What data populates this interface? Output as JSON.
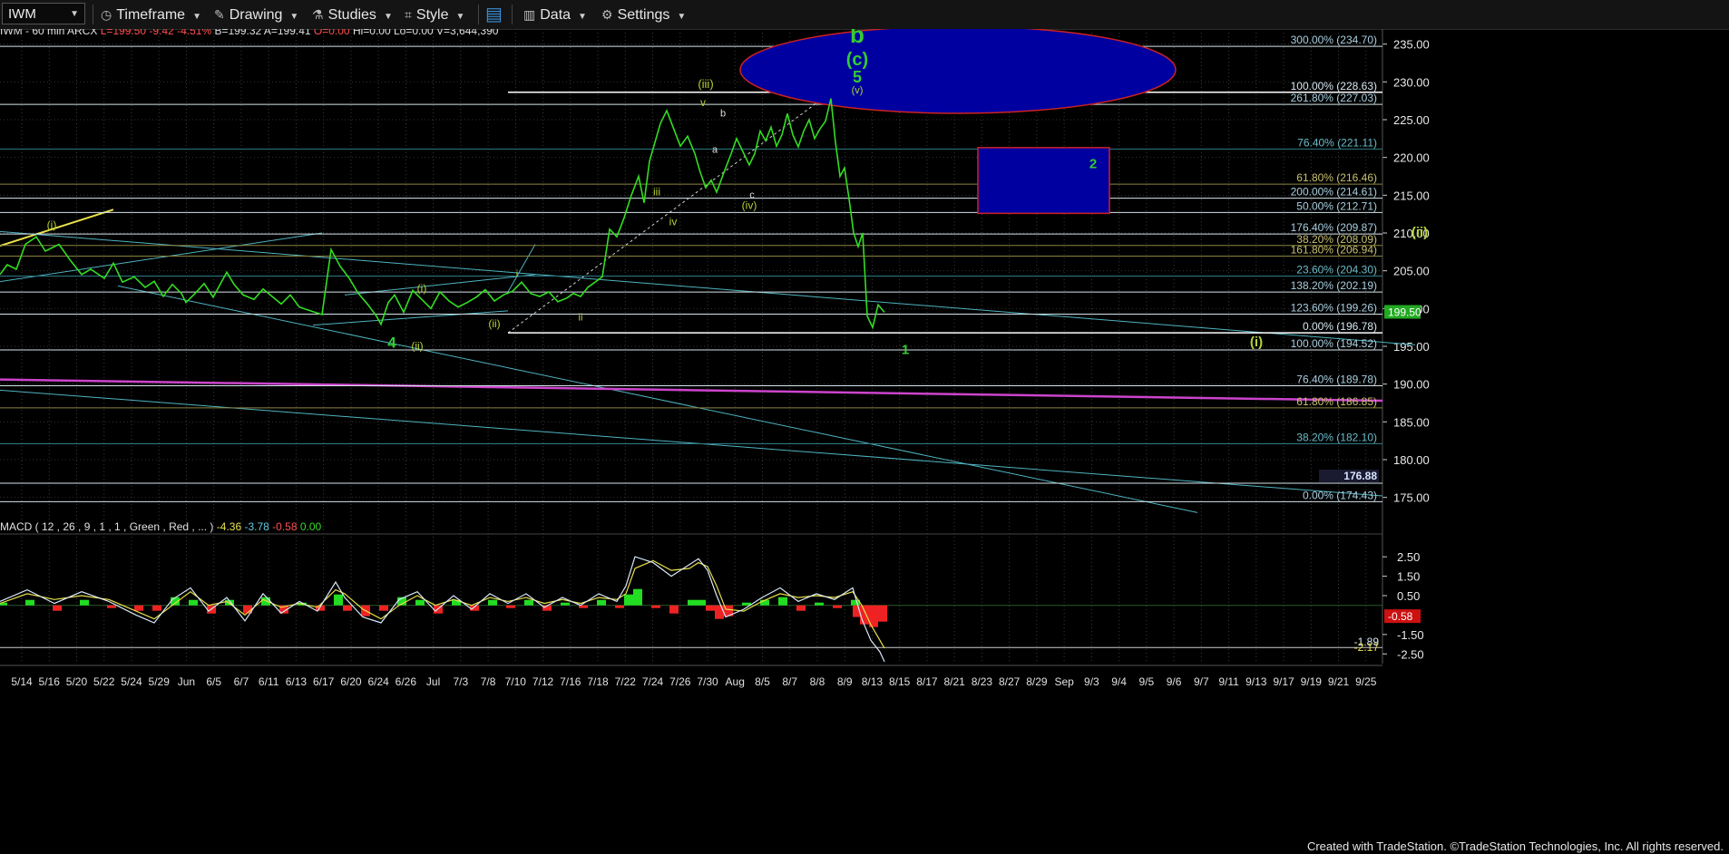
{
  "toolbar": {
    "symbol": "IWM",
    "items": [
      {
        "label": "Timeframe",
        "icon": "clock-icon"
      },
      {
        "label": "Drawing",
        "icon": "pencil-icon"
      },
      {
        "label": "Studies",
        "icon": "flask-icon"
      },
      {
        "label": "Style",
        "icon": "style-icon"
      },
      {
        "label": "",
        "icon": "layout-icon"
      },
      {
        "label": "Data",
        "icon": "bar-chart-icon"
      },
      {
        "label": "Settings",
        "icon": "gear-icon"
      }
    ]
  },
  "colors": {
    "price_line": "#33dd22",
    "fib_level": "#a9cfe0",
    "fib_label": "#a9cfe0",
    "fib_gold": "#c8c070",
    "magenta": "#cc44cc",
    "yellow_line": "#e8e14a",
    "teal_line": "#4fb3c0",
    "ellipse_fill": "#0000a0",
    "ellipse_stroke": "#cc2222",
    "box_fill": "#0000a0",
    "box_stroke": "#cc2222",
    "wave_green": "#33cc33",
    "wave_olive": "#b5d334"
  },
  "chart_data": {
    "type": "line",
    "header": {
      "symbol": "IWM - 60 min",
      "exchange": "ARCX",
      "last": "L=199.50",
      "change": "-9.42",
      "change_pct": "-4.51%",
      "bid": "B=199.32",
      "ask": "A=199.41",
      "open": "O=0.00",
      "high": "Hi=0.00",
      "low": "Lo=0.00",
      "volume": "V=3,644,390"
    },
    "ylim": [
      171,
      237
    ],
    "y_ticks": [
      175,
      180,
      185,
      190,
      195,
      200,
      205,
      210,
      215,
      220,
      225,
      230,
      235
    ],
    "y_tick_labels": [
      "175.00",
      "180.00",
      "185.00",
      "190.00",
      "195.00",
      "200.00",
      "205.00",
      "210.00",
      "215.00",
      "220.00",
      "225.00",
      "230.00",
      "235.00"
    ],
    "last_price_label": "199.50",
    "x_tick_labels": [
      "5/14",
      "5/16",
      "5/20",
      "5/22",
      "5/24",
      "5/29",
      "Jun",
      "6/5",
      "6/7",
      "6/11",
      "6/13",
      "6/17",
      "6/20",
      "6/24",
      "6/26",
      "Jul",
      "7/3",
      "7/8",
      "7/10",
      "7/12",
      "7/16",
      "7/18",
      "7/22",
      "7/24",
      "7/26",
      "7/30",
      "Aug",
      "8/5",
      "8/7",
      "8/8",
      "8/9",
      "8/13",
      "8/15",
      "8/17",
      "8/21",
      "8/23",
      "8/27",
      "8/29",
      "Sep",
      "9/3",
      "9/4",
      "9/5",
      "9/6",
      "9/7",
      "9/11",
      "9/13",
      "9/17",
      "9/19",
      "9/21",
      "9/25"
    ],
    "price_path": [
      [
        0,
        204.5
      ],
      [
        0.008,
        205.8
      ],
      [
        0.018,
        205.2
      ],
      [
        0.028,
        208.5
      ],
      [
        0.04,
        209.5
      ],
      [
        0.05,
        207.6
      ],
      [
        0.065,
        208.5
      ],
      [
        0.078,
        206.3
      ],
      [
        0.09,
        204.5
      ],
      [
        0.1,
        205.2
      ],
      [
        0.115,
        204.0
      ],
      [
        0.125,
        206.0
      ],
      [
        0.135,
        203.5
      ],
      [
        0.148,
        204.2
      ],
      [
        0.16,
        202.8
      ],
      [
        0.17,
        203.6
      ],
      [
        0.18,
        201.6
      ],
      [
        0.19,
        203.2
      ],
      [
        0.2,
        202.0
      ],
      [
        0.205,
        200.8
      ],
      [
        0.215,
        202.0
      ],
      [
        0.225,
        203.3
      ],
      [
        0.235,
        201.5
      ],
      [
        0.25,
        204.8
      ],
      [
        0.258,
        203.2
      ],
      [
        0.268,
        201.8
      ],
      [
        0.28,
        201.2
      ],
      [
        0.29,
        202.6
      ],
      [
        0.3,
        201.6
      ],
      [
        0.31,
        200.6
      ],
      [
        0.32,
        201.8
      ],
      [
        0.33,
        200.2
      ],
      [
        0.345,
        199.6
      ],
      [
        0.355,
        199.2
      ],
      [
        0.365,
        207.8
      ],
      [
        0.375,
        205.6
      ],
      [
        0.385,
        204.0
      ],
      [
        0.395,
        202.0
      ],
      [
        0.405,
        200.6
      ],
      [
        0.415,
        199.0
      ],
      [
        0.42,
        197.9
      ],
      [
        0.428,
        200.8
      ],
      [
        0.435,
        201.8
      ],
      [
        0.445,
        199.5
      ],
      [
        0.455,
        202.4
      ],
      [
        0.465,
        201.2
      ],
      [
        0.475,
        200.0
      ],
      [
        0.485,
        202.2
      ],
      [
        0.495,
        201.0
      ],
      [
        0.505,
        200.2
      ],
      [
        0.515,
        200.8
      ],
      [
        0.525,
        201.5
      ],
      [
        0.535,
        202.5
      ],
      [
        0.545,
        201.0
      ],
      [
        0.555,
        201.8
      ],
      [
        0.565,
        202.3
      ],
      [
        0.575,
        203.5
      ],
      [
        0.585,
        202.0
      ],
      [
        0.595,
        201.6
      ],
      [
        0.605,
        202.2
      ],
      [
        0.615,
        200.9
      ],
      [
        0.625,
        201.4
      ],
      [
        0.632,
        202.0
      ],
      [
        0.64,
        201.6
      ],
      [
        0.648,
        202.8
      ],
      [
        0.656,
        203.5
      ],
      [
        0.664,
        204.2
      ],
      [
        0.672,
        210.5
      ],
      [
        0.68,
        209.5
      ],
      [
        0.688,
        212.0
      ],
      [
        0.696,
        215.0
      ],
      [
        0.704,
        217.5
      ],
      [
        0.71,
        214.0
      ],
      [
        0.716,
        219.5
      ],
      [
        0.722,
        222.0
      ],
      [
        0.728,
        224.5
      ],
      [
        0.735,
        226.2
      ],
      [
        0.742,
        224.0
      ],
      [
        0.75,
        221.5
      ],
      [
        0.758,
        222.8
      ],
      [
        0.766,
        220.5
      ],
      [
        0.772,
        218.0
      ],
      [
        0.778,
        216.0
      ],
      [
        0.784,
        217.0
      ],
      [
        0.79,
        215.4
      ],
      [
        0.798,
        218.0
      ],
      [
        0.806,
        220.5
      ],
      [
        0.812,
        222.5
      ],
      [
        0.818,
        221.0
      ],
      [
        0.826,
        219.0
      ],
      [
        0.832,
        220.5
      ],
      [
        0.838,
        223.5
      ],
      [
        0.844,
        222.2
      ],
      [
        0.85,
        224.0
      ],
      [
        0.856,
        221.5
      ],
      [
        0.862,
        223.0
      ],
      [
        0.868,
        225.8
      ],
      [
        0.874,
        223.0
      ],
      [
        0.88,
        221.4
      ],
      [
        0.886,
        223.5
      ],
      [
        0.892,
        225.0
      ],
      [
        0.898,
        222.5
      ],
      [
        0.904,
        223.8
      ],
      [
        0.91,
        224.8
      ],
      [
        0.916,
        227.8
      ],
      [
        0.921,
        222.0
      ],
      [
        0.926,
        217.5
      ],
      [
        0.931,
        218.6
      ],
      [
        0.936,
        214.5
      ],
      [
        0.941,
        210.0
      ],
      [
        0.946,
        208.2
      ],
      [
        0.951,
        210.0
      ],
      [
        0.956,
        199.0
      ],
      [
        0.962,
        197.5
      ],
      [
        0.968,
        200.5
      ],
      [
        0.975,
        199.5
      ]
    ],
    "fib_levels": [
      {
        "label": "300.00% (234.70)",
        "value": 234.7,
        "style": "white"
      },
      {
        "label": "100.00% (228.63)",
        "value": 228.63,
        "style": "white-thick"
      },
      {
        "label": "261.80% (227.03)",
        "value": 227.03,
        "style": "white"
      },
      {
        "label": "76.40% (221.11)",
        "value": 221.11,
        "style": "teal"
      },
      {
        "label": "61.80% (216.46)",
        "value": 216.46,
        "style": "gold"
      },
      {
        "label": "200.00% (214.61)",
        "value": 214.61,
        "style": "white"
      },
      {
        "label": "50.00% (212.71)",
        "value": 212.71,
        "style": "white"
      },
      {
        "label": "176.40% (209.87)",
        "value": 209.87,
        "style": "white"
      },
      {
        "label": "38.20% (208.09)",
        "value": 208.35,
        "style": "gold"
      },
      {
        "label": "161.80% (206.94)",
        "value": 206.94,
        "style": "gold"
      },
      {
        "label": "23.60% (204.30)",
        "value": 204.3,
        "style": "teal"
      },
      {
        "label": "138.20% (202.19)",
        "value": 202.19,
        "style": "white"
      },
      {
        "label": "123.60% (199.26)",
        "value": 199.26,
        "style": "white"
      },
      {
        "label": "0.00% (196.78)",
        "value": 196.78,
        "style": "white-thick"
      },
      {
        "label": "100.00% (194.52)",
        "value": 194.52,
        "style": "white"
      },
      {
        "label": "76.40% (189.78)",
        "value": 189.78,
        "style": "white"
      },
      {
        "label": "61.80% (186.85)",
        "value": 186.85,
        "style": "gold"
      },
      {
        "label": "38.20% (182.10)",
        "value": 182.1,
        "style": "teal"
      },
      {
        "label": "176.88",
        "value": 176.88,
        "style": "white-tag"
      },
      {
        "label": "0.00% (174.43)",
        "value": 174.43,
        "style": "white"
      }
    ],
    "wave_labels": [
      {
        "text": "b",
        "x": 0.945,
        "y": 235.2,
        "size": 26,
        "color": "wave_green",
        "weight": "bold"
      },
      {
        "text": "(c)",
        "x": 0.945,
        "y": 232.2,
        "size": 20,
        "color": "wave_green",
        "weight": "bold"
      },
      {
        "text": "5",
        "x": 0.945,
        "y": 229.9,
        "size": 18,
        "color": "wave_green",
        "weight": "bold"
      },
      {
        "text": "(v)",
        "x": 0.945,
        "y": 228.5,
        "size": 11,
        "color": "wave_olive",
        "weight": "normal"
      },
      {
        "text": "(iii)",
        "x": 0.778,
        "y": 229.2,
        "size": 13,
        "color": "wave_olive",
        "weight": "normal"
      },
      {
        "text": "v",
        "x": 0.775,
        "y": 226.8,
        "size": 12,
        "color": "wave_olive",
        "weight": "normal"
      },
      {
        "text": "b",
        "x": 0.797,
        "y": 225.4,
        "size": 11,
        "color": "#dddddd",
        "weight": "normal"
      },
      {
        "text": "a",
        "x": 0.788,
        "y": 220.6,
        "size": 11,
        "color": "#dddddd",
        "weight": "normal"
      },
      {
        "text": "c",
        "x": 0.829,
        "y": 214.6,
        "size": 11,
        "color": "#dddddd",
        "weight": "normal"
      },
      {
        "text": "(iv)",
        "x": 0.826,
        "y": 213.2,
        "size": 12,
        "color": "wave_olive",
        "weight": "normal"
      },
      {
        "text": "iii",
        "x": 0.724,
        "y": 215.0,
        "size": 12,
        "color": "wave_olive",
        "weight": "normal"
      },
      {
        "text": "iv",
        "x": 0.742,
        "y": 211.0,
        "size": 12,
        "color": "wave_olive",
        "weight": "normal"
      },
      {
        "text": "(i)",
        "x": 0.057,
        "y": 210.6,
        "size": 12,
        "color": "wave_olive",
        "weight": "normal"
      },
      {
        "text": "(i)",
        "x": 0.465,
        "y": 202.2,
        "size": 12,
        "color": "wave_olive",
        "weight": "normal"
      },
      {
        "text": "i",
        "x": 0.57,
        "y": 204.2,
        "size": 11,
        "color": "wave_olive",
        "weight": "normal"
      },
      {
        "text": "(ii)",
        "x": 0.545,
        "y": 197.5,
        "size": 12,
        "color": "wave_olive",
        "weight": "normal"
      },
      {
        "text": "ii",
        "x": 0.64,
        "y": 198.4,
        "size": 11,
        "color": "wave_olive",
        "weight": "normal"
      },
      {
        "text": "4",
        "x": 0.432,
        "y": 194.8,
        "size": 17,
        "color": "wave_green",
        "weight": "bold"
      },
      {
        "text": "(ii)",
        "x": 0.46,
        "y": 194.6,
        "size": 12,
        "color": "wave_olive",
        "weight": "normal"
      },
      {
        "text": "2",
        "x": 1.205,
        "y": 218.6,
        "size": 15,
        "color": "wave_green",
        "weight": "bold"
      },
      {
        "text": "1",
        "x": 0.998,
        "y": 194.0,
        "size": 15,
        "color": "wave_green",
        "weight": "bold"
      },
      {
        "text": "(i)",
        "x": 1.385,
        "y": 195.0,
        "size": 15,
        "color": "wave_olive",
        "weight": "bold"
      },
      {
        "text": "(ii)",
        "x": 1.565,
        "y": 209.5,
        "size": 15,
        "color": "wave_olive",
        "weight": "bold"
      }
    ],
    "macd": {
      "label": "MACD ( 12 , 26 , 9 , 1 , 1 , Green , Red , ... )",
      "values": [
        "-4.36",
        "-3.78",
        "-0.58",
        "0.00"
      ],
      "value_colors": [
        "#e8e14a",
        "#60c8e0",
        "#ff5050",
        "#33dd22"
      ],
      "ylim": [
        -3.0,
        3.3
      ],
      "y_ticks": [
        2.5,
        1.5,
        0.5,
        -1.5,
        -2.5
      ],
      "y_tick_labels": [
        "2.50",
        "1.50",
        "0.50",
        "-1.50",
        "-2.50"
      ],
      "extra_tags": [
        "-0.58",
        "-1.89",
        "-2.17"
      ],
      "macd_line": [
        [
          0,
          0.2
        ],
        [
          0.03,
          0.8
        ],
        [
          0.06,
          0.1
        ],
        [
          0.09,
          0.7
        ],
        [
          0.12,
          0.2
        ],
        [
          0.15,
          -0.5
        ],
        [
          0.17,
          -0.9
        ],
        [
          0.19,
          0.3
        ],
        [
          0.21,
          0.9
        ],
        [
          0.23,
          -0.3
        ],
        [
          0.25,
          0.4
        ],
        [
          0.27,
          -0.8
        ],
        [
          0.29,
          0.6
        ],
        [
          0.31,
          -0.4
        ],
        [
          0.33,
          0.2
        ],
        [
          0.35,
          -0.3
        ],
        [
          0.37,
          1.2
        ],
        [
          0.38,
          0.4
        ],
        [
          0.4,
          -0.6
        ],
        [
          0.42,
          -0.9
        ],
        [
          0.44,
          0.3
        ],
        [
          0.46,
          0.7
        ],
        [
          0.48,
          -0.3
        ],
        [
          0.5,
          0.5
        ],
        [
          0.52,
          -0.2
        ],
        [
          0.54,
          0.6
        ],
        [
          0.56,
          0.1
        ],
        [
          0.58,
          0.6
        ],
        [
          0.6,
          -0.1
        ],
        [
          0.62,
          0.4
        ],
        [
          0.64,
          0.0
        ],
        [
          0.66,
          0.6
        ],
        [
          0.68,
          0.2
        ],
        [
          0.69,
          1.0
        ],
        [
          0.7,
          2.5
        ],
        [
          0.72,
          2.2
        ],
        [
          0.74,
          1.5
        ],
        [
          0.76,
          2.1
        ],
        [
          0.77,
          2.4
        ],
        [
          0.78,
          1.8
        ],
        [
          0.79,
          0.5
        ],
        [
          0.8,
          -0.6
        ],
        [
          0.82,
          -0.2
        ],
        [
          0.84,
          0.4
        ],
        [
          0.86,
          0.9
        ],
        [
          0.88,
          0.2
        ],
        [
          0.9,
          0.6
        ],
        [
          0.92,
          0.3
        ],
        [
          0.94,
          0.9
        ],
        [
          0.95,
          -0.7
        ],
        [
          0.96,
          -1.8
        ],
        [
          0.97,
          -2.4
        ],
        [
          0.975,
          -2.9
        ]
      ],
      "signal_line": [
        [
          0,
          0.1
        ],
        [
          0.03,
          0.6
        ],
        [
          0.06,
          0.3
        ],
        [
          0.09,
          0.5
        ],
        [
          0.12,
          0.3
        ],
        [
          0.15,
          -0.3
        ],
        [
          0.17,
          -0.7
        ],
        [
          0.19,
          0.0
        ],
        [
          0.21,
          0.7
        ],
        [
          0.23,
          0.0
        ],
        [
          0.25,
          0.2
        ],
        [
          0.27,
          -0.5
        ],
        [
          0.29,
          0.3
        ],
        [
          0.31,
          -0.1
        ],
        [
          0.33,
          0.1
        ],
        [
          0.35,
          -0.1
        ],
        [
          0.37,
          0.8
        ],
        [
          0.38,
          0.6
        ],
        [
          0.4,
          -0.2
        ],
        [
          0.42,
          -0.7
        ],
        [
          0.44,
          0.0
        ],
        [
          0.46,
          0.5
        ],
        [
          0.48,
          0.0
        ],
        [
          0.5,
          0.3
        ],
        [
          0.52,
          0.0
        ],
        [
          0.54,
          0.4
        ],
        [
          0.56,
          0.2
        ],
        [
          0.58,
          0.4
        ],
        [
          0.6,
          0.1
        ],
        [
          0.62,
          0.3
        ],
        [
          0.64,
          0.1
        ],
        [
          0.66,
          0.4
        ],
        [
          0.68,
          0.3
        ],
        [
          0.69,
          0.6
        ],
        [
          0.7,
          1.9
        ],
        [
          0.72,
          2.3
        ],
        [
          0.74,
          1.8
        ],
        [
          0.76,
          1.9
        ],
        [
          0.77,
          2.2
        ],
        [
          0.78,
          2.0
        ],
        [
          0.79,
          1.0
        ],
        [
          0.8,
          -0.2
        ],
        [
          0.82,
          -0.3
        ],
        [
          0.84,
          0.2
        ],
        [
          0.86,
          0.6
        ],
        [
          0.88,
          0.4
        ],
        [
          0.9,
          0.5
        ],
        [
          0.92,
          0.4
        ],
        [
          0.94,
          0.7
        ],
        [
          0.95,
          0.0
        ],
        [
          0.96,
          -1.0
        ],
        [
          0.97,
          -1.8
        ],
        [
          0.975,
          -2.2
        ]
      ]
    },
    "credit": "Created with TradeStation. ©TradeStation Technologies, Inc. All rights reserved."
  }
}
